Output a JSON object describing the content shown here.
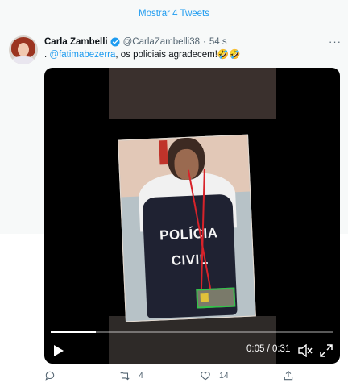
{
  "banner": {
    "show_more": "Mostrar 4 Tweets"
  },
  "tweet": {
    "author_name": "Carla Zambelli",
    "handle": "@CarlaZambelli38",
    "separator": "·",
    "time": "54 s",
    "text_prefix": ". ",
    "mention": "@fatimabezerra",
    "text_rest": ", os policiais agradecem!🤣🤣",
    "more_icon": "more-horizontal-icon"
  },
  "video": {
    "vest_line1": "POLÍCIA",
    "vest_line2": "CIVIL",
    "time": "0:05 / 0:31",
    "progress": 0.16
  },
  "actions": {
    "reply_count": "",
    "retweet_count": "4",
    "like_count": "14",
    "share_count": ""
  },
  "colors": {
    "accent": "#1d9bf0",
    "muted": "#536471"
  }
}
